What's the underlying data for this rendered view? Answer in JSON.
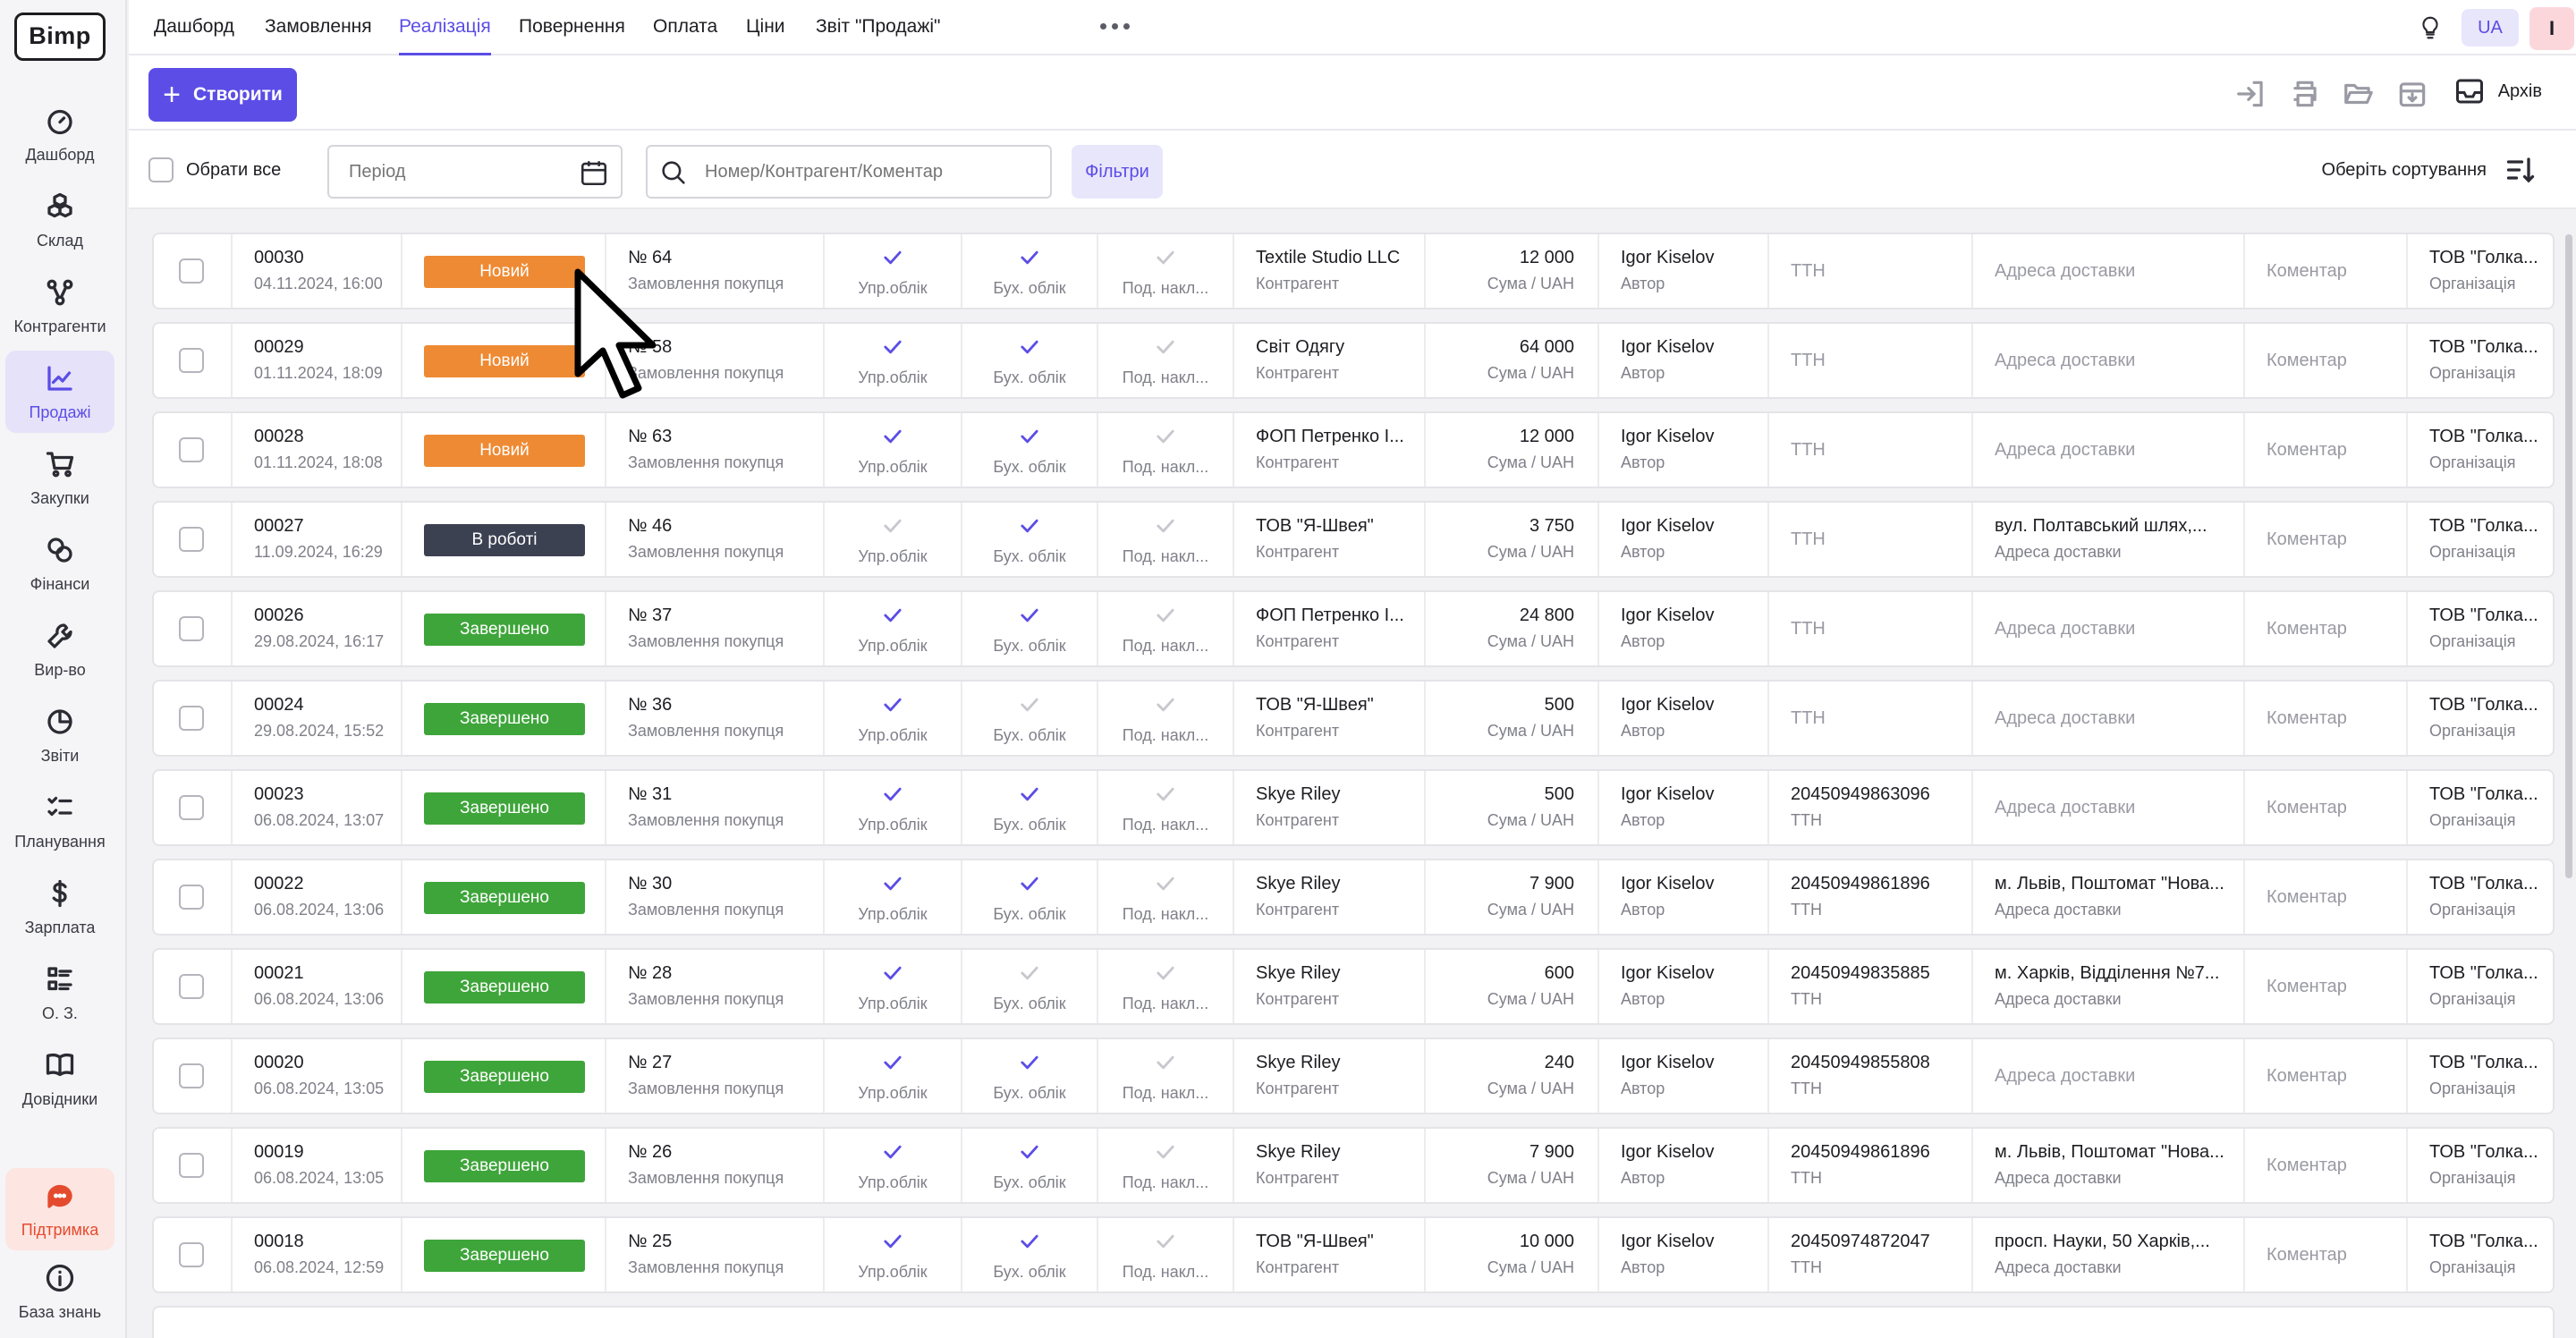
{
  "app": {
    "logo": "Bimp"
  },
  "sidebar": {
    "items": [
      {
        "label": "Дашборд",
        "icon": "gauge-icon",
        "active": false
      },
      {
        "label": "Склад",
        "icon": "boxes-icon",
        "active": false
      },
      {
        "label": "Контрагенти",
        "icon": "network-icon",
        "active": false
      },
      {
        "label": "Продажі",
        "icon": "chart-line-icon",
        "active": true
      },
      {
        "label": "Закупки",
        "icon": "cart-icon",
        "active": false
      },
      {
        "label": "Фінанси",
        "icon": "coins-icon",
        "active": false
      },
      {
        "label": "Вир-во",
        "icon": "wrench-icon",
        "active": false
      },
      {
        "label": "Звіти",
        "icon": "pie-chart-icon",
        "active": false
      },
      {
        "label": "Планування",
        "icon": "checklist-icon",
        "active": false
      },
      {
        "label": "Зарплата",
        "icon": "dollar-icon",
        "active": false
      },
      {
        "label": "О. З.",
        "icon": "list-grid-icon",
        "active": false
      },
      {
        "label": "Довідники",
        "icon": "book-icon",
        "active": false
      }
    ],
    "support": {
      "label": "Підтримка",
      "icon": "chat-icon"
    },
    "knowledge": {
      "label": "База знань",
      "icon": "info-icon"
    }
  },
  "topnav": {
    "tabs": [
      {
        "label": "Дашборд"
      },
      {
        "label": "Замовлення"
      },
      {
        "label": "Реалізація"
      },
      {
        "label": "Повернення"
      },
      {
        "label": "Оплата"
      },
      {
        "label": "Ціни"
      },
      {
        "label": "Звіт \"Продажі\""
      }
    ],
    "active_tab": "Реалізація",
    "lang": "UA",
    "avatar": "I"
  },
  "toolbar": {
    "create_label": "Створити",
    "archive_label": "Архів"
  },
  "filterbar": {
    "select_all": "Обрати все",
    "period_placeholder": "Період",
    "search_placeholder": "Номер/Контрагент/Коментар",
    "filters_label": "Фільтри",
    "sort_label": "Оберіть сортування"
  },
  "labels": {
    "doc_sub": "Замовлення покупця",
    "upr": "Упр.облік",
    "buh": "Бух. облік",
    "pod": "Под. накл...",
    "counterparty_sub": "Контрагент",
    "sum_sub": "Сума",
    "currency": "UAH",
    "author_sub": "Автор",
    "tth": "ТТН",
    "address": "Адреса доставки",
    "comment": "Коментар",
    "org_sub": "Організація"
  },
  "colors": {
    "accent": "#5b4de6",
    "status_new": "#ee8a33",
    "status_in_work": "#3c4152",
    "status_done": "#3ea53a"
  },
  "rows": [
    {
      "num": "00030",
      "date": "04.11.2024, 16:00",
      "status": "Новий",
      "status_type": "new",
      "doc": "№ 64",
      "upr": true,
      "buh": true,
      "pod": false,
      "counterparty": "Textile Studio LLC",
      "sum": "12 000",
      "author": "Igor Kiselov",
      "tth": "",
      "address": "",
      "org": "ТОВ \"Голка..."
    },
    {
      "num": "00029",
      "date": "01.11.2024, 18:09",
      "status": "Новий",
      "status_type": "new",
      "doc": "№ 58",
      "upr": true,
      "buh": true,
      "pod": false,
      "counterparty": "Світ Одягу",
      "sum": "64 000",
      "author": "Igor Kiselov",
      "tth": "",
      "address": "",
      "org": "ТОВ \"Голка..."
    },
    {
      "num": "00028",
      "date": "01.11.2024, 18:08",
      "status": "Новий",
      "status_type": "new",
      "doc": "№ 63",
      "upr": true,
      "buh": true,
      "pod": false,
      "counterparty": "ФОП Петренко І...",
      "sum": "12 000",
      "author": "Igor Kiselov",
      "tth": "",
      "address": "",
      "org": "ТОВ \"Голка..."
    },
    {
      "num": "00027",
      "date": "11.09.2024, 16:29",
      "status": "В роботі",
      "status_type": "work",
      "doc": "№ 46",
      "upr": false,
      "buh": true,
      "pod": false,
      "counterparty": "ТОВ \"Я-Швея\"",
      "sum": "3 750",
      "author": "Igor Kiselov",
      "tth": "",
      "address": "вул. Полтавський шлях,...",
      "org": "ТОВ \"Голка..."
    },
    {
      "num": "00026",
      "date": "29.08.2024, 16:17",
      "status": "Завершено",
      "status_type": "done",
      "doc": "№ 37",
      "upr": true,
      "buh": true,
      "pod": false,
      "counterparty": "ФОП Петренко І...",
      "sum": "24 800",
      "author": "Igor Kiselov",
      "tth": "",
      "address": "",
      "org": "ТОВ \"Голка..."
    },
    {
      "num": "00024",
      "date": "29.08.2024, 15:52",
      "status": "Завершено",
      "status_type": "done",
      "doc": "№ 36",
      "upr": true,
      "buh": false,
      "pod": false,
      "counterparty": "ТОВ \"Я-Швея\"",
      "sum": "500",
      "author": "Igor Kiselov",
      "tth": "",
      "address": "",
      "org": "ТОВ \"Голка..."
    },
    {
      "num": "00023",
      "date": "06.08.2024, 13:07",
      "status": "Завершено",
      "status_type": "done",
      "doc": "№ 31",
      "upr": true,
      "buh": true,
      "pod": false,
      "counterparty": "Skye Riley",
      "sum": "500",
      "author": "Igor Kiselov",
      "tth": "20450949863096",
      "address": "",
      "org": "ТОВ \"Голка..."
    },
    {
      "num": "00022",
      "date": "06.08.2024, 13:06",
      "status": "Завершено",
      "status_type": "done",
      "doc": "№ 30",
      "upr": true,
      "buh": true,
      "pod": false,
      "counterparty": "Skye Riley",
      "sum": "7 900",
      "author": "Igor Kiselov",
      "tth": "20450949861896",
      "address": "м. Львів, Поштомат \"Нова...",
      "org": "ТОВ \"Голка..."
    },
    {
      "num": "00021",
      "date": "06.08.2024, 13:06",
      "status": "Завершено",
      "status_type": "done",
      "doc": "№ 28",
      "upr": true,
      "buh": false,
      "pod": false,
      "counterparty": "Skye Riley",
      "sum": "600",
      "author": "Igor Kiselov",
      "tth": "20450949835885",
      "address": "м. Харків, Відділення №7...",
      "org": "ТОВ \"Голка..."
    },
    {
      "num": "00020",
      "date": "06.08.2024, 13:05",
      "status": "Завершено",
      "status_type": "done",
      "doc": "№ 27",
      "upr": true,
      "buh": true,
      "pod": false,
      "counterparty": "Skye Riley",
      "sum": "240",
      "author": "Igor Kiselov",
      "tth": "20450949855808",
      "address": "",
      "org": "ТОВ \"Голка..."
    },
    {
      "num": "00019",
      "date": "06.08.2024, 13:05",
      "status": "Завершено",
      "status_type": "done",
      "doc": "№ 26",
      "upr": true,
      "buh": true,
      "pod": false,
      "counterparty": "Skye Riley",
      "sum": "7 900",
      "author": "Igor Kiselov",
      "tth": "20450949861896",
      "address": "м. Львів, Поштомат \"Нова...",
      "org": "ТОВ \"Голка..."
    },
    {
      "num": "00018",
      "date": "06.08.2024, 12:59",
      "status": "Завершено",
      "status_type": "done",
      "doc": "№ 25",
      "upr": true,
      "buh": true,
      "pod": false,
      "counterparty": "ТОВ \"Я-Швея\"",
      "sum": "10 000",
      "author": "Igor Kiselov",
      "tth": "20450974872047",
      "address": "просп. Науки, 50 Харків,...",
      "org": "ТОВ \"Голка..."
    }
  ]
}
